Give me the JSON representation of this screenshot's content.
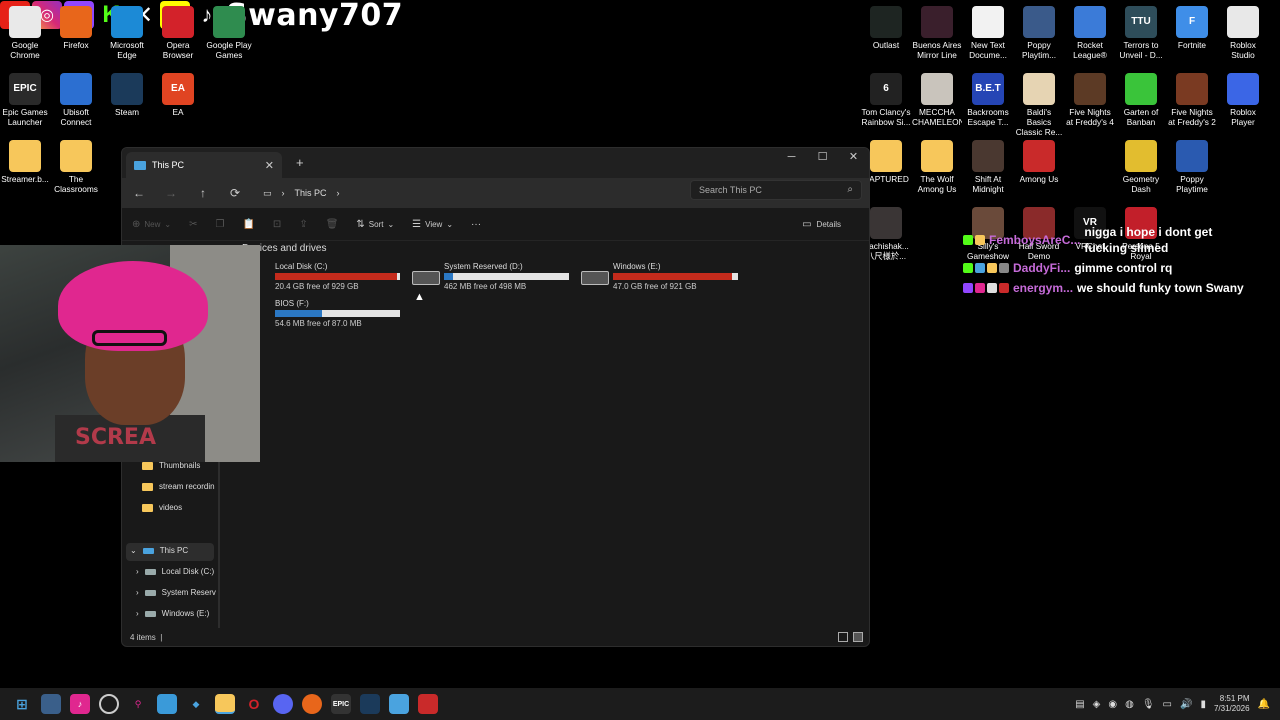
{
  "overlay": {
    "handle": "Swany707",
    "socials": [
      "youtube-icon",
      "instagram-icon",
      "twitch-icon",
      "kick-icon",
      "x-icon",
      "snapchat-icon",
      "tiktok-icon"
    ]
  },
  "desktop_icons_left": [
    {
      "label": "Google Chrome",
      "color": "#e9e9e9"
    },
    {
      "label": "Firefox",
      "color": "#e8661b"
    },
    {
      "label": "Microsoft Edge",
      "color": "#1c8ad6"
    },
    {
      "label": "Opera Browser",
      "color": "#d3222a"
    },
    {
      "label": "Google Play Games",
      "color": "#2f8c4f"
    },
    {
      "label": "Epic Games Launcher",
      "color": "#2a2a2a",
      "text": "EPIC"
    },
    {
      "label": "Ubisoft Connect",
      "color": "#2c6fd1"
    },
    {
      "label": "Steam",
      "color": "#1b3a5a"
    },
    {
      "label": "EA",
      "color": "#e04422",
      "text": "EA"
    },
    {
      "label": "Streamer.b...",
      "color": "#f7c75b"
    },
    {
      "label": "The Classrooms",
      "color": "#f7c75b"
    }
  ],
  "desktop_icons_right": [
    {
      "label": "Outlast",
      "color": "#1e2522"
    },
    {
      "label": "Buenos Aires Mirror Line",
      "color": "#3a1f2c"
    },
    {
      "label": "New Text Docume...",
      "color": "#f2f2f2"
    },
    {
      "label": "Poppy Playtim...",
      "color": "#3a5a8a"
    },
    {
      "label": "Rocket League®",
      "color": "#3b7bd8"
    },
    {
      "label": "Terrors to Unveil - D...",
      "color": "#2e4d5a",
      "text": "TTU"
    },
    {
      "label": "Fortnite",
      "color": "#3f8ee8",
      "text": "F"
    },
    {
      "label": "Roblox Studio",
      "color": "#e8e8e8"
    },
    {
      "label": "Tom Clancy's Rainbow Si...",
      "color": "#222",
      "text": "6"
    },
    {
      "label": "MECCHA CHAMELEON",
      "color": "#c9c4bc"
    },
    {
      "label": "Backrooms Escape T...",
      "color": "#2545b5",
      "text": "B.E.T"
    },
    {
      "label": "Baldi's Basics Classic Re...",
      "color": "#e6d4b3"
    },
    {
      "label": "Five Nights at Freddy's 4",
      "color": "#5c3a25"
    },
    {
      "label": "Garten of Banban",
      "color": "#3ac43a"
    },
    {
      "label": "Five Nights at Freddy's 2",
      "color": "#7a3a22"
    },
    {
      "label": "Roblox Player",
      "color": "#3b66e6"
    },
    {
      "label": "CAPTURED",
      "color": "#f7c75b"
    },
    {
      "label": "The Wolf Among Us",
      "color": "#f7c75b"
    },
    {
      "label": "Shift At Midnight",
      "color": "#4a3830"
    },
    {
      "label": "Among Us",
      "color": "#c92a2a"
    },
    {
      "label": "Geometry Dash",
      "color": "#e2bd2f"
    },
    {
      "label": "Poppy Playtime",
      "color": "#2a5ab0"
    },
    {
      "label": "Hachishak... 八尺様於...",
      "color": "#3a3535"
    },
    {
      "label": "Silly's Gameshow",
      "color": "#6a4a3a"
    },
    {
      "label": "Half Sword Demo",
      "color": "#8a2a2a"
    },
    {
      "label": "VRChat",
      "color": "#111",
      "text": "VR"
    },
    {
      "label": "Persona 5 Royal",
      "color": "#c21f2a"
    }
  ],
  "chat": [
    {
      "user": "FemboysAreC...",
      "msg": "nigga i hope i dont get fucking slimed"
    },
    {
      "user": "DaddyFi...",
      "msg": "gimme control rq"
    },
    {
      "user": "energym...",
      "msg": "we should funky town Swany"
    }
  ],
  "explorer": {
    "tab_title": "This PC",
    "breadcrumb": "This PC",
    "search_placeholder": "Search This PC",
    "cmd": {
      "new": "New",
      "sort": "Sort",
      "view": "View",
      "details": "Details"
    },
    "group_header": "Devices and drives",
    "drives": [
      {
        "name": "Local Disk (C:)",
        "free": "20.4 GB free of 929 GB",
        "used_fraction": 0.978,
        "color": "#c42b1c"
      },
      {
        "name": "System Reserved (D:)",
        "free": "462 MB free of 498 MB",
        "used_fraction": 0.072,
        "color": "#2b78c4"
      },
      {
        "name": "Windows (E:)",
        "free": "47.0 GB free of 921 GB",
        "used_fraction": 0.949,
        "color": "#c42b1c"
      },
      {
        "name": "BIOS (F:)",
        "free": "54.6 MB free of 87.0 MB",
        "used_fraction": 0.372,
        "color": "#2b78c4"
      }
    ],
    "sidebar": [
      {
        "label": "Thumbnails",
        "type": "folder"
      },
      {
        "label": "stream recordin",
        "type": "folder"
      },
      {
        "label": "videos",
        "type": "folder"
      },
      {
        "label": "This PC",
        "type": "pc"
      },
      {
        "label": "Local Disk (C:)",
        "type": "drive"
      },
      {
        "label": "System Reserv",
        "type": "drive"
      },
      {
        "label": "Windows (E:)",
        "type": "drive"
      }
    ],
    "status": "4 items"
  },
  "webcam": {
    "shirt_text": "SCREA"
  },
  "taskbar": {
    "time": "8:51 PM",
    "date": "7/31/2026"
  }
}
